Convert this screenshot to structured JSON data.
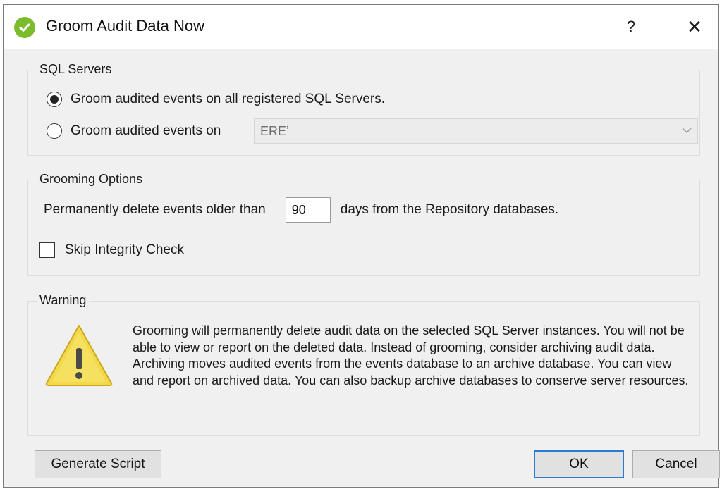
{
  "window": {
    "title": "Groom Audit Data Now",
    "help_label": "?",
    "close_label": "✕",
    "icon": "check-circle-icon"
  },
  "sql_servers": {
    "label": "SQL Servers",
    "option_all": "Groom audited events on all registered SQL Servers.",
    "option_on": "Groom audited events on",
    "selected": "all",
    "server_value": "EREʼ"
  },
  "grooming": {
    "label": "Grooming Options",
    "prefix": "Permanently delete events older than",
    "days": "90",
    "suffix": "days from the Repository databases.",
    "skip_integrity_label": "Skip Integrity Check",
    "skip_integrity_checked": false
  },
  "warning": {
    "label": "Warning",
    "icon": "warning-icon",
    "text": "Grooming will permanently delete audit data on the selected SQL Server instances. You will not be able to view or report on the deleted data. Instead of grooming, consider archiving audit data. Archiving moves audited events from the events database to an archive database. You can view and report on archived data. You can also backup archive databases to conserve server resources."
  },
  "buttons": {
    "generate_script": "Generate Script",
    "ok": "OK",
    "cancel": "Cancel"
  },
  "colors": {
    "accent": "#2a7bd4",
    "title_icon": "#7cbb2c",
    "warning_fill": "#f3d94a"
  }
}
